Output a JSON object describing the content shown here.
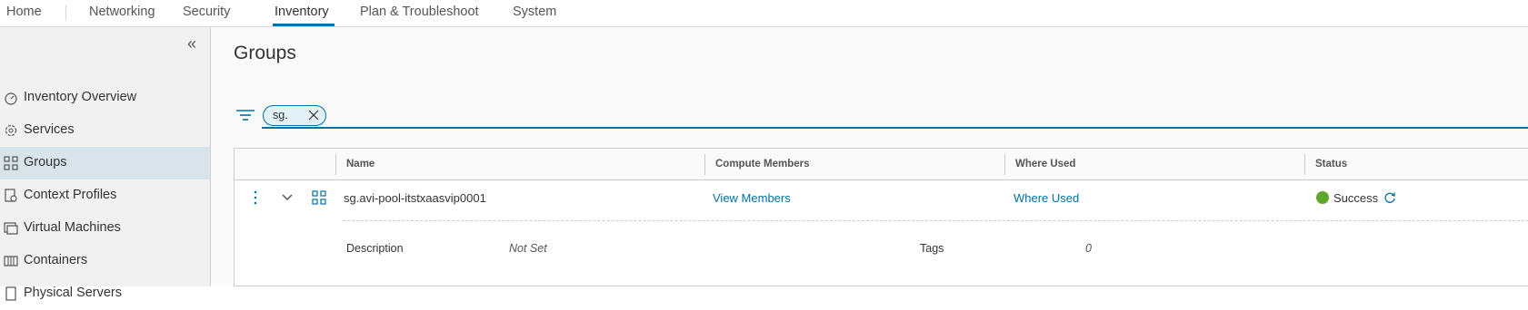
{
  "topnav": {
    "tabs": [
      {
        "label": "Home"
      },
      {
        "label": "Networking"
      },
      {
        "label": "Security"
      },
      {
        "label": "Inventory",
        "active": true
      },
      {
        "label": "Plan & Troubleshoot"
      },
      {
        "label": "System"
      }
    ]
  },
  "sidebar": {
    "items": [
      {
        "label": "Inventory Overview",
        "icon": "dashboard-icon"
      },
      {
        "label": "Services",
        "icon": "gear-icon"
      },
      {
        "label": "Groups",
        "icon": "groups-icon",
        "active": true
      },
      {
        "label": "Context Profiles",
        "icon": "context-profile-icon"
      },
      {
        "label": "Virtual Machines",
        "icon": "vm-icon"
      },
      {
        "label": "Containers",
        "icon": "container-icon"
      },
      {
        "label": "Physical Servers",
        "icon": "server-icon"
      }
    ]
  },
  "main": {
    "title": "Groups",
    "filter": {
      "chip_label": "sg."
    },
    "grid": {
      "columns": [
        "Name",
        "Compute Members",
        "Where Used",
        "Status"
      ],
      "rows": [
        {
          "name": "sg.avi-pool-itstxaasvip0001",
          "compute_members": "View Members",
          "where_used": "Where Used",
          "status": "Success",
          "description_label": "Description",
          "description_value": "Not Set",
          "tags_label": "Tags",
          "tags_value": "0"
        }
      ]
    }
  },
  "colors": {
    "accent": "#0072a3",
    "status_success": "#5ea72a",
    "sidebar_active": "#d9e4ea"
  }
}
